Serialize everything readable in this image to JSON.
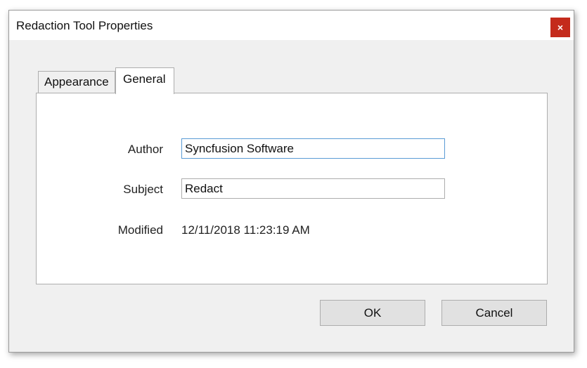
{
  "window": {
    "title": "Redaction Tool Properties",
    "close_icon": "×"
  },
  "tabs": [
    {
      "label": "Appearance",
      "selected": false
    },
    {
      "label": "General",
      "selected": true
    }
  ],
  "fields": {
    "author": {
      "label": "Author",
      "value": "Syncfusion Software"
    },
    "subject": {
      "label": "Subject",
      "value": "Redact"
    },
    "modified": {
      "label": "Modified",
      "value": "12/11/2018 11:23:19 AM"
    }
  },
  "buttons": {
    "ok": "OK",
    "cancel": "Cancel"
  },
  "colors": {
    "close_button": "#c42b1c",
    "focus_border": "#5a9bd5"
  }
}
